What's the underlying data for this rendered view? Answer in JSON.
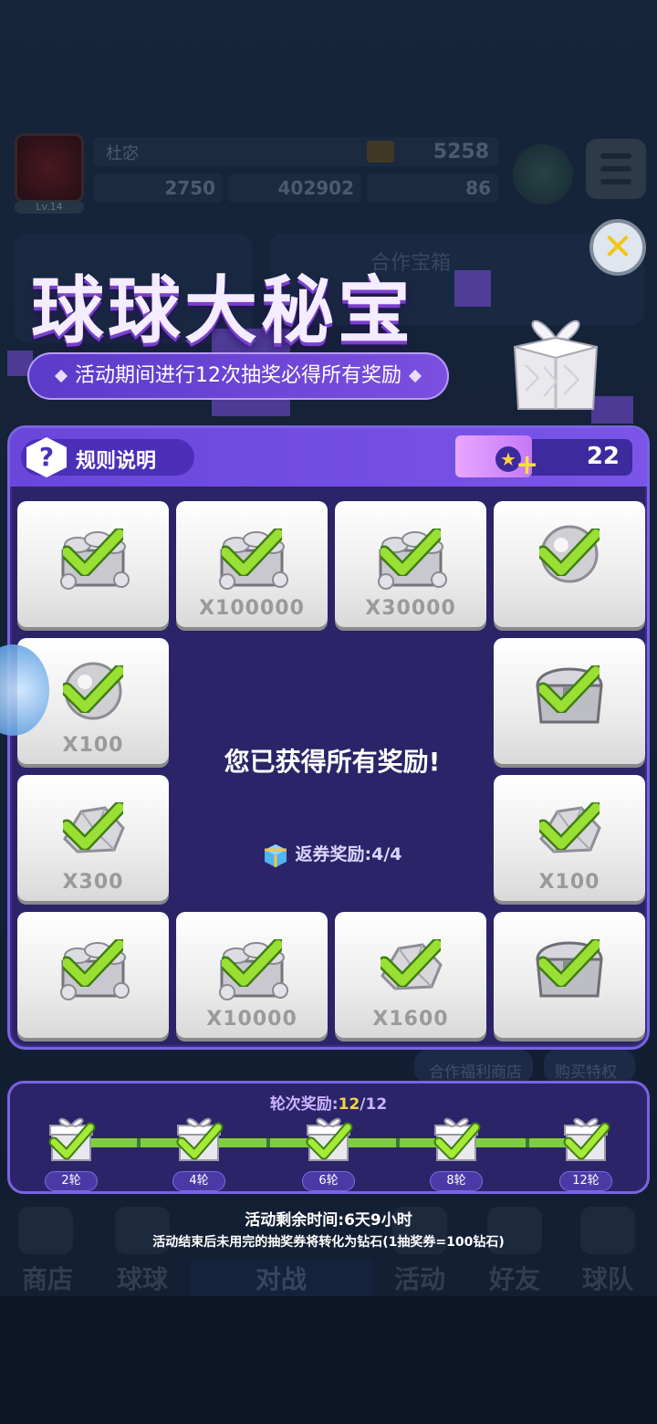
{
  "background": {
    "player_name": "杜宓",
    "level": "Lv.14",
    "trophies": "5258",
    "stat_1": "2750",
    "coins": "402902",
    "gems": "86",
    "coop_chest": "合作宝箱",
    "coop_shop": "合作福利商店",
    "buy_privilege": "购买特权",
    "nav": [
      "商店",
      "球球",
      "对战",
      "活动",
      "好友",
      "球队"
    ]
  },
  "modal": {
    "title": "球球大秘宝",
    "subtitle": "活动期间进行12次抽奖必得所有奖励",
    "rules_label": "规则说明",
    "rules_icon": "?",
    "ticket_count": "22",
    "center_message": "您已获得所有奖励!",
    "refund_text": "返券奖励:4/4",
    "close_icon": "close-icon",
    "rewards": [
      {
        "qty": "",
        "icon": "coin-diamond-chest-icon"
      },
      {
        "qty": "X100000",
        "icon": "coin-crate-icon"
      },
      {
        "qty": "X30000",
        "icon": "coin-crate-icon"
      },
      {
        "qty": "",
        "icon": "orb-icon"
      },
      {
        "qty": "X100",
        "icon": "orb-icon"
      },
      {
        "qty": "",
        "icon": "treasure-chest-icon"
      },
      {
        "qty": "X300",
        "icon": "rock-icon"
      },
      {
        "qty": "X100",
        "icon": "rock-icon"
      },
      {
        "qty": "",
        "icon": "gem-chest-icon"
      },
      {
        "qty": "X10000",
        "icon": "coin-crate-icon"
      },
      {
        "qty": "X1600",
        "icon": "rock-pile-icon"
      },
      {
        "qty": "",
        "icon": "treasure-chest-icon"
      }
    ]
  },
  "rounds": {
    "title_prefix": "轮次奖励:",
    "current": "12",
    "total": "/12",
    "nodes": [
      "2轮",
      "4轮",
      "6轮",
      "8轮",
      "12轮"
    ],
    "progress": 1.0
  },
  "footer": {
    "time_left": "活动剩余时间:6天9小时",
    "note": "活动结束后未用完的抽奖券将转化为钻石(1抽奖券=100钻石)"
  },
  "colors": {
    "panel": "#2b2468",
    "panel_border": "#7a63e3",
    "accent_yellow": "#f5d640",
    "check_green": "#8fdc2c"
  }
}
